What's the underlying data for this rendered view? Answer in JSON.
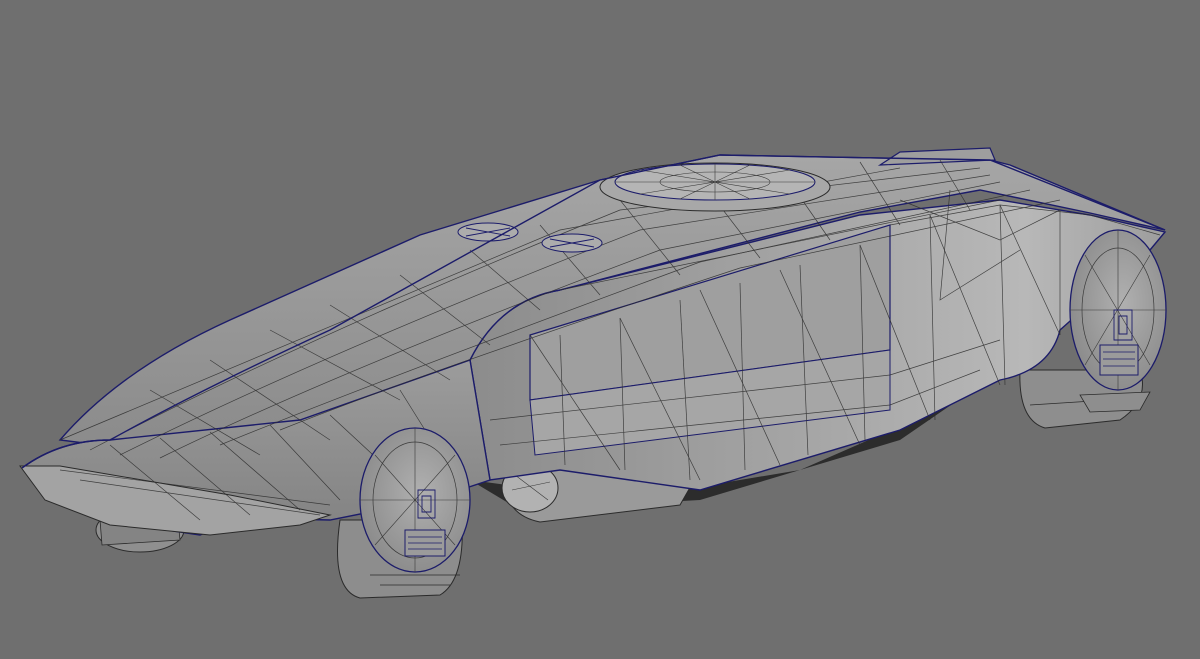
{
  "scene": {
    "subject": "vehicle-wireframe-model",
    "view": "perspective",
    "shading": "smooth-shade-with-wireframe"
  },
  "colors": {
    "background": "#6f6f6f",
    "body_light": "#b4b4b4",
    "body_mid": "#9a9a9a",
    "body_dark": "#7e7e7e",
    "shadow": "#3a3a3a",
    "wire": "#2a2a2a",
    "outline": "#1c1c6a"
  }
}
